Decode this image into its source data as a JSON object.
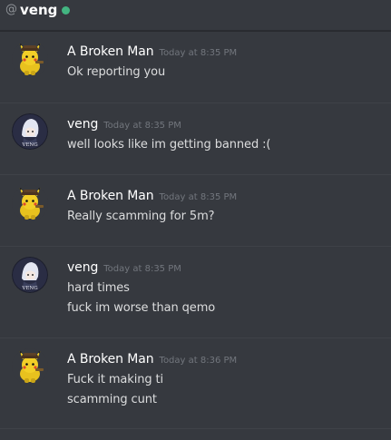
{
  "header": {
    "at_symbol": "@",
    "channel_name": "veng",
    "status_color": "#43b581"
  },
  "messages": [
    {
      "author": "A Broken Man",
      "avatar": "pikachu-avatar",
      "timestamp": "Today at 8:35 PM",
      "lines": [
        "Ok reporting you"
      ]
    },
    {
      "author": "veng",
      "avatar": "anime-avatar",
      "avatar_caption": "VENG",
      "timestamp": "Today at 8:35 PM",
      "lines": [
        "well looks like im getting banned :("
      ]
    },
    {
      "author": "A Broken Man",
      "avatar": "pikachu-avatar",
      "timestamp": "Today at 8:35 PM",
      "lines": [
        "Really scamming for 5m?"
      ]
    },
    {
      "author": "veng",
      "avatar": "anime-avatar",
      "avatar_caption": "VENG",
      "timestamp": "Today at 8:35 PM",
      "lines": [
        "hard times",
        "fuck im worse than qemo"
      ]
    },
    {
      "author": "A Broken Man",
      "avatar": "pikachu-avatar",
      "timestamp": "Today at 8:36 PM",
      "lines": [
        "Fuck it making ti",
        "scamming cunt"
      ]
    }
  ]
}
